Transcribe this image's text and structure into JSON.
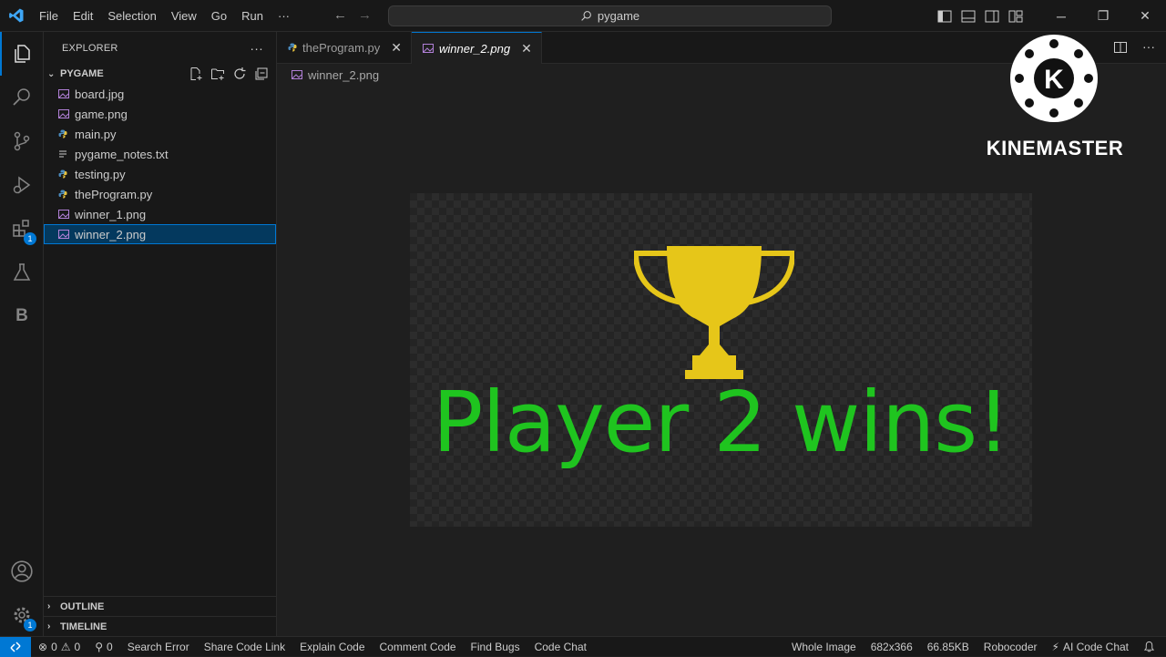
{
  "menu": [
    "File",
    "Edit",
    "Selection",
    "View",
    "Go",
    "Run",
    "···"
  ],
  "search": {
    "text": "pygame"
  },
  "explorer": {
    "title": "EXPLORER",
    "more": "···",
    "folder": "PYGAME",
    "files": [
      {
        "name": "board.jpg",
        "icon": "image-file-icon"
      },
      {
        "name": "game.png",
        "icon": "image-file-icon"
      },
      {
        "name": "main.py",
        "icon": "python-file-icon"
      },
      {
        "name": "pygame_notes.txt",
        "icon": "text-file-icon"
      },
      {
        "name": "testing.py",
        "icon": "python-file-icon"
      },
      {
        "name": "theProgram.py",
        "icon": "python-file-icon"
      },
      {
        "name": "winner_1.png",
        "icon": "image-file-icon"
      },
      {
        "name": "winner_2.png",
        "icon": "image-file-icon",
        "selected": true
      }
    ],
    "outline": "OUTLINE",
    "timeline": "TIMELINE"
  },
  "activity": {
    "extensions_badge": "1",
    "account_badge": "1",
    "b_label": "B"
  },
  "tabs": [
    {
      "label": "theProgram.py",
      "icon": "python-file-icon",
      "active": false
    },
    {
      "label": "winner_2.png",
      "icon": "image-file-icon",
      "active": true
    }
  ],
  "breadcrumb": "winner_2.png",
  "preview": {
    "text": "Player 2 wins!",
    "text_color": "#1fc41f",
    "trophy_color": "#e6c619"
  },
  "watermark": {
    "brand": "KINEMASTER",
    "letter": "K"
  },
  "status": {
    "errors": "0",
    "warnings": "0",
    "ports": "0",
    "items_left": [
      "Search Error",
      "Share Code Link",
      "Explain Code",
      "Comment Code",
      "Find Bugs",
      "Code Chat"
    ],
    "items_right": [
      "Whole Image",
      "682x366",
      "66.85KB",
      "Robocoder"
    ],
    "ai_chat": "AI Code Chat"
  },
  "colors": {
    "accent": "#0078d4",
    "selection": "#04395e"
  }
}
